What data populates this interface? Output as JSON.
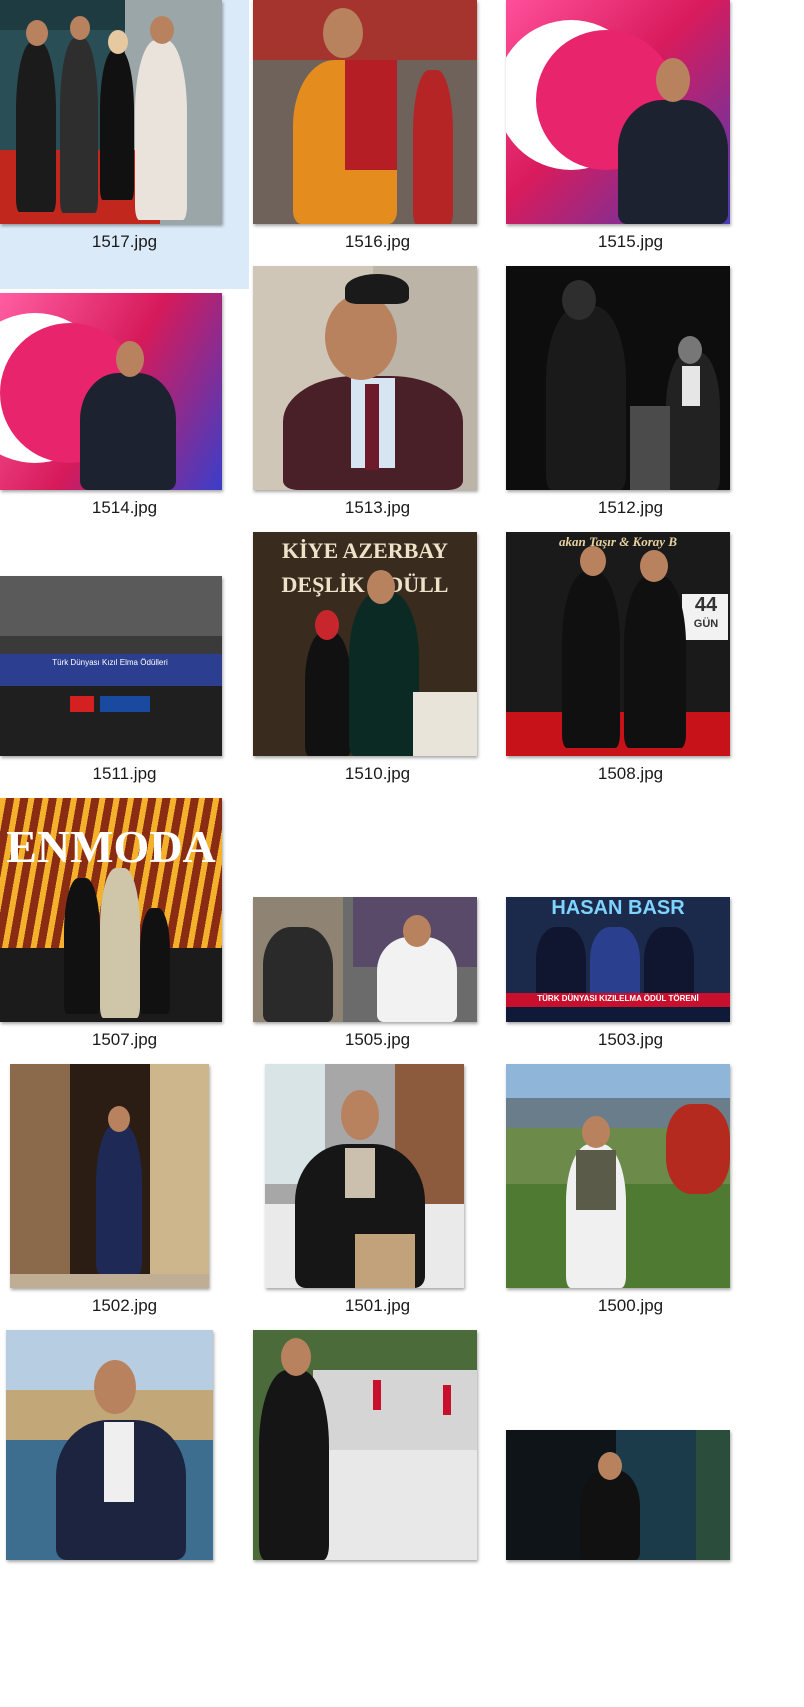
{
  "files": [
    {
      "name": "1517.jpg",
      "selected": true
    },
    {
      "name": "1516.jpg"
    },
    {
      "name": "1515.jpg"
    },
    {
      "name": "1514.jpg"
    },
    {
      "name": "1513.jpg"
    },
    {
      "name": "1512.jpg"
    },
    {
      "name": "1511.jpg"
    },
    {
      "name": "1510.jpg"
    },
    {
      "name": "1508.jpg"
    },
    {
      "name": "1507.jpg"
    },
    {
      "name": "1505.jpg"
    },
    {
      "name": "1503.jpg"
    },
    {
      "name": "1502.jpg"
    },
    {
      "name": "1501.jpg"
    },
    {
      "name": "1500.jpg"
    },
    {
      "name": "",
      "partial": true
    },
    {
      "name": "",
      "partial": true
    },
    {
      "name": "",
      "partial": true
    }
  ],
  "thumb_text": {
    "1510_banner": "KİYE AZERBAY",
    "1510_banner2": "DEŞLİK ÖDÜLL",
    "1508_banner": "akan Taşır & Koray B",
    "1508_days": "44",
    "1508_gun": "GÜN",
    "1507_banner": "ENMODA",
    "1503_banner": "HASAN BASR",
    "1503_caption": "TÜRK DÜNYASI KIZILELMA ÖDÜL TÖRENİ",
    "1511_banner": "Türk Dünyası Kızıl Elma Ödülleri"
  }
}
